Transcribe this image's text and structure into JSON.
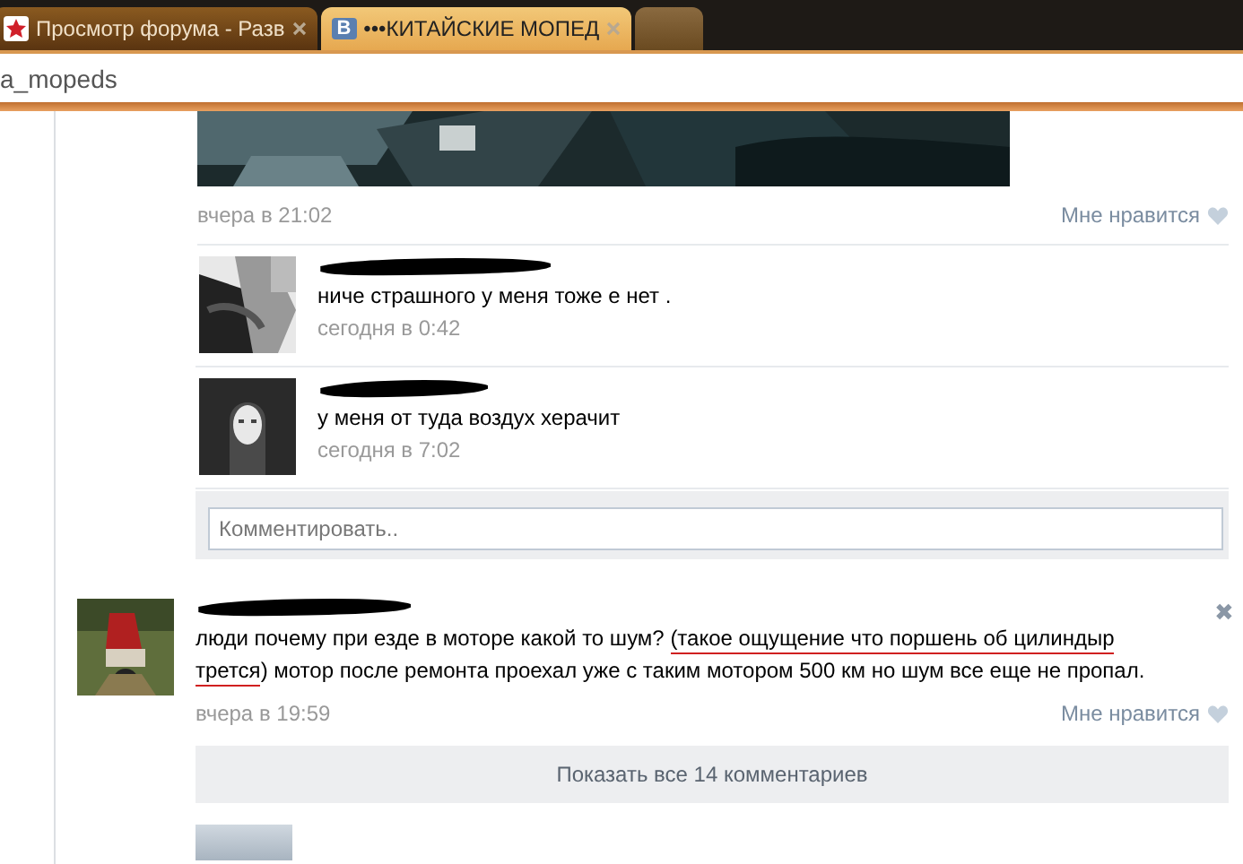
{
  "tabs": [
    {
      "kind": "star",
      "title": "Просмотр форума - Разв",
      "selected": false
    },
    {
      "kind": "letter",
      "title": "•••КИТАЙСКИЕ МОПЕД",
      "favicon": "В",
      "selected": true
    },
    {
      "kind": "blank",
      "selected": false
    }
  ],
  "address": "a_mopeds",
  "post_top": {
    "picture": {
      "kind": "picture"
    },
    "time": "вчера в 21:02",
    "like": "Мне нравится"
  },
  "comments": [
    {
      "avatar": {
        "kind": "picture"
      },
      "text": "ниче страшного у меня тоже е нет .",
      "time": "сегодня в 0:42"
    },
    {
      "avatar": {
        "kind": "picture"
      },
      "text": "у меня от туда воздух херачит",
      "time": "сегодня в 7:02"
    }
  ],
  "comment_field": {
    "placeholder": "Комментировать.."
  },
  "post": {
    "avatar": {
      "kind": "picture"
    },
    "lines": [
      [
        {
          "text": "люди почему при езде в моторе какой то шум? ",
          "misspelled": false
        },
        {
          "text": "(такое ощущение что поршень об цилиндыр",
          "misspelled": true
        }
      ],
      [
        {
          "text": "трется",
          "misspelled": true
        },
        {
          "text": ") мотор после ремонта проехал уже с таким мотором 500 км но шум все еще не пропал.",
          "misspelled": false
        }
      ]
    ],
    "time": "вчера в 19:59",
    "like": "Мне нравится",
    "close": "✖",
    "show_all": "Показать все 14 комментариев"
  }
}
